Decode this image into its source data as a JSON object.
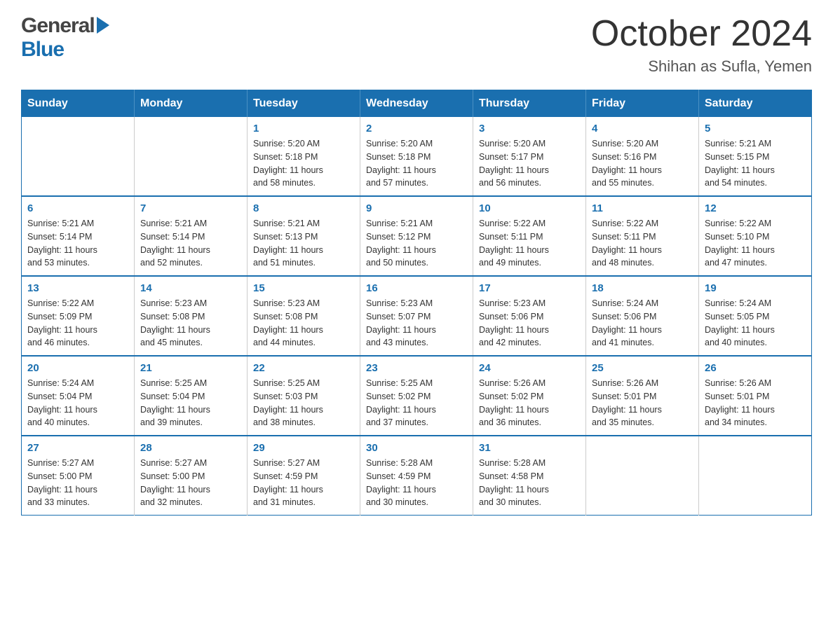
{
  "header": {
    "logo_general": "General",
    "logo_blue": "Blue",
    "month_title": "October 2024",
    "location": "Shihan as Sufla, Yemen"
  },
  "calendar": {
    "days_of_week": [
      "Sunday",
      "Monday",
      "Tuesday",
      "Wednesday",
      "Thursday",
      "Friday",
      "Saturday"
    ],
    "weeks": [
      [
        {
          "day": "",
          "info": ""
        },
        {
          "day": "",
          "info": ""
        },
        {
          "day": "1",
          "info": "Sunrise: 5:20 AM\nSunset: 5:18 PM\nDaylight: 11 hours\nand 58 minutes."
        },
        {
          "day": "2",
          "info": "Sunrise: 5:20 AM\nSunset: 5:18 PM\nDaylight: 11 hours\nand 57 minutes."
        },
        {
          "day": "3",
          "info": "Sunrise: 5:20 AM\nSunset: 5:17 PM\nDaylight: 11 hours\nand 56 minutes."
        },
        {
          "day": "4",
          "info": "Sunrise: 5:20 AM\nSunset: 5:16 PM\nDaylight: 11 hours\nand 55 minutes."
        },
        {
          "day": "5",
          "info": "Sunrise: 5:21 AM\nSunset: 5:15 PM\nDaylight: 11 hours\nand 54 minutes."
        }
      ],
      [
        {
          "day": "6",
          "info": "Sunrise: 5:21 AM\nSunset: 5:14 PM\nDaylight: 11 hours\nand 53 minutes."
        },
        {
          "day": "7",
          "info": "Sunrise: 5:21 AM\nSunset: 5:14 PM\nDaylight: 11 hours\nand 52 minutes."
        },
        {
          "day": "8",
          "info": "Sunrise: 5:21 AM\nSunset: 5:13 PM\nDaylight: 11 hours\nand 51 minutes."
        },
        {
          "day": "9",
          "info": "Sunrise: 5:21 AM\nSunset: 5:12 PM\nDaylight: 11 hours\nand 50 minutes."
        },
        {
          "day": "10",
          "info": "Sunrise: 5:22 AM\nSunset: 5:11 PM\nDaylight: 11 hours\nand 49 minutes."
        },
        {
          "day": "11",
          "info": "Sunrise: 5:22 AM\nSunset: 5:11 PM\nDaylight: 11 hours\nand 48 minutes."
        },
        {
          "day": "12",
          "info": "Sunrise: 5:22 AM\nSunset: 5:10 PM\nDaylight: 11 hours\nand 47 minutes."
        }
      ],
      [
        {
          "day": "13",
          "info": "Sunrise: 5:22 AM\nSunset: 5:09 PM\nDaylight: 11 hours\nand 46 minutes."
        },
        {
          "day": "14",
          "info": "Sunrise: 5:23 AM\nSunset: 5:08 PM\nDaylight: 11 hours\nand 45 minutes."
        },
        {
          "day": "15",
          "info": "Sunrise: 5:23 AM\nSunset: 5:08 PM\nDaylight: 11 hours\nand 44 minutes."
        },
        {
          "day": "16",
          "info": "Sunrise: 5:23 AM\nSunset: 5:07 PM\nDaylight: 11 hours\nand 43 minutes."
        },
        {
          "day": "17",
          "info": "Sunrise: 5:23 AM\nSunset: 5:06 PM\nDaylight: 11 hours\nand 42 minutes."
        },
        {
          "day": "18",
          "info": "Sunrise: 5:24 AM\nSunset: 5:06 PM\nDaylight: 11 hours\nand 41 minutes."
        },
        {
          "day": "19",
          "info": "Sunrise: 5:24 AM\nSunset: 5:05 PM\nDaylight: 11 hours\nand 40 minutes."
        }
      ],
      [
        {
          "day": "20",
          "info": "Sunrise: 5:24 AM\nSunset: 5:04 PM\nDaylight: 11 hours\nand 40 minutes."
        },
        {
          "day": "21",
          "info": "Sunrise: 5:25 AM\nSunset: 5:04 PM\nDaylight: 11 hours\nand 39 minutes."
        },
        {
          "day": "22",
          "info": "Sunrise: 5:25 AM\nSunset: 5:03 PM\nDaylight: 11 hours\nand 38 minutes."
        },
        {
          "day": "23",
          "info": "Sunrise: 5:25 AM\nSunset: 5:02 PM\nDaylight: 11 hours\nand 37 minutes."
        },
        {
          "day": "24",
          "info": "Sunrise: 5:26 AM\nSunset: 5:02 PM\nDaylight: 11 hours\nand 36 minutes."
        },
        {
          "day": "25",
          "info": "Sunrise: 5:26 AM\nSunset: 5:01 PM\nDaylight: 11 hours\nand 35 minutes."
        },
        {
          "day": "26",
          "info": "Sunrise: 5:26 AM\nSunset: 5:01 PM\nDaylight: 11 hours\nand 34 minutes."
        }
      ],
      [
        {
          "day": "27",
          "info": "Sunrise: 5:27 AM\nSunset: 5:00 PM\nDaylight: 11 hours\nand 33 minutes."
        },
        {
          "day": "28",
          "info": "Sunrise: 5:27 AM\nSunset: 5:00 PM\nDaylight: 11 hours\nand 32 minutes."
        },
        {
          "day": "29",
          "info": "Sunrise: 5:27 AM\nSunset: 4:59 PM\nDaylight: 11 hours\nand 31 minutes."
        },
        {
          "day": "30",
          "info": "Sunrise: 5:28 AM\nSunset: 4:59 PM\nDaylight: 11 hours\nand 30 minutes."
        },
        {
          "day": "31",
          "info": "Sunrise: 5:28 AM\nSunset: 4:58 PM\nDaylight: 11 hours\nand 30 minutes."
        },
        {
          "day": "",
          "info": ""
        },
        {
          "day": "",
          "info": ""
        }
      ]
    ]
  }
}
